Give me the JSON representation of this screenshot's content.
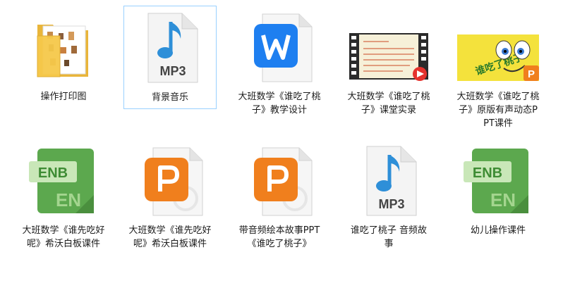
{
  "files": [
    {
      "name": "操作打印图",
      "icon": "folder-icon"
    },
    {
      "name": "背景音乐",
      "icon": "mp3-audio-icon",
      "type_label": "MP3",
      "selected": true
    },
    {
      "name": "大班数学《谁吃了桃子》教学设计",
      "icon": "wps-writer-icon"
    },
    {
      "name": "大班数学《谁吃了桃子》课堂实录",
      "icon": "video-thumbnail-icon"
    },
    {
      "name": "大班数学《谁吃了桃子》原版有声动态PPT课件",
      "icon": "ppt-thumbnail-icon",
      "thumb_text": "谁吃了桃子"
    },
    {
      "name": "大班数学《谁先吃好呢》希沃白板课件",
      "icon": "enb-file-icon",
      "badge": "ENB",
      "sub": "EN"
    },
    {
      "name": "大班数学《谁先吃好呢》希沃白板课件",
      "icon": "wps-presentation-icon"
    },
    {
      "name": "带音频绘本故事PPT《谁吃了桃子》",
      "icon": "wps-presentation-icon"
    },
    {
      "name": "谁吃了桃子 音频故事",
      "icon": "mp3-audio-icon",
      "type_label": "MP3"
    },
    {
      "name": "幼儿操作课件",
      "icon": "enb-file-icon",
      "badge": "ENB",
      "sub": "EN"
    }
  ],
  "colors": {
    "selection_border": "#99d1ff",
    "mp3_note": "#2e8fd8",
    "wps_blue": "#1e7ff0",
    "wps_orange": "#f07f1d",
    "enb_green": "#5ca84e",
    "folder": "#f5c84a"
  }
}
